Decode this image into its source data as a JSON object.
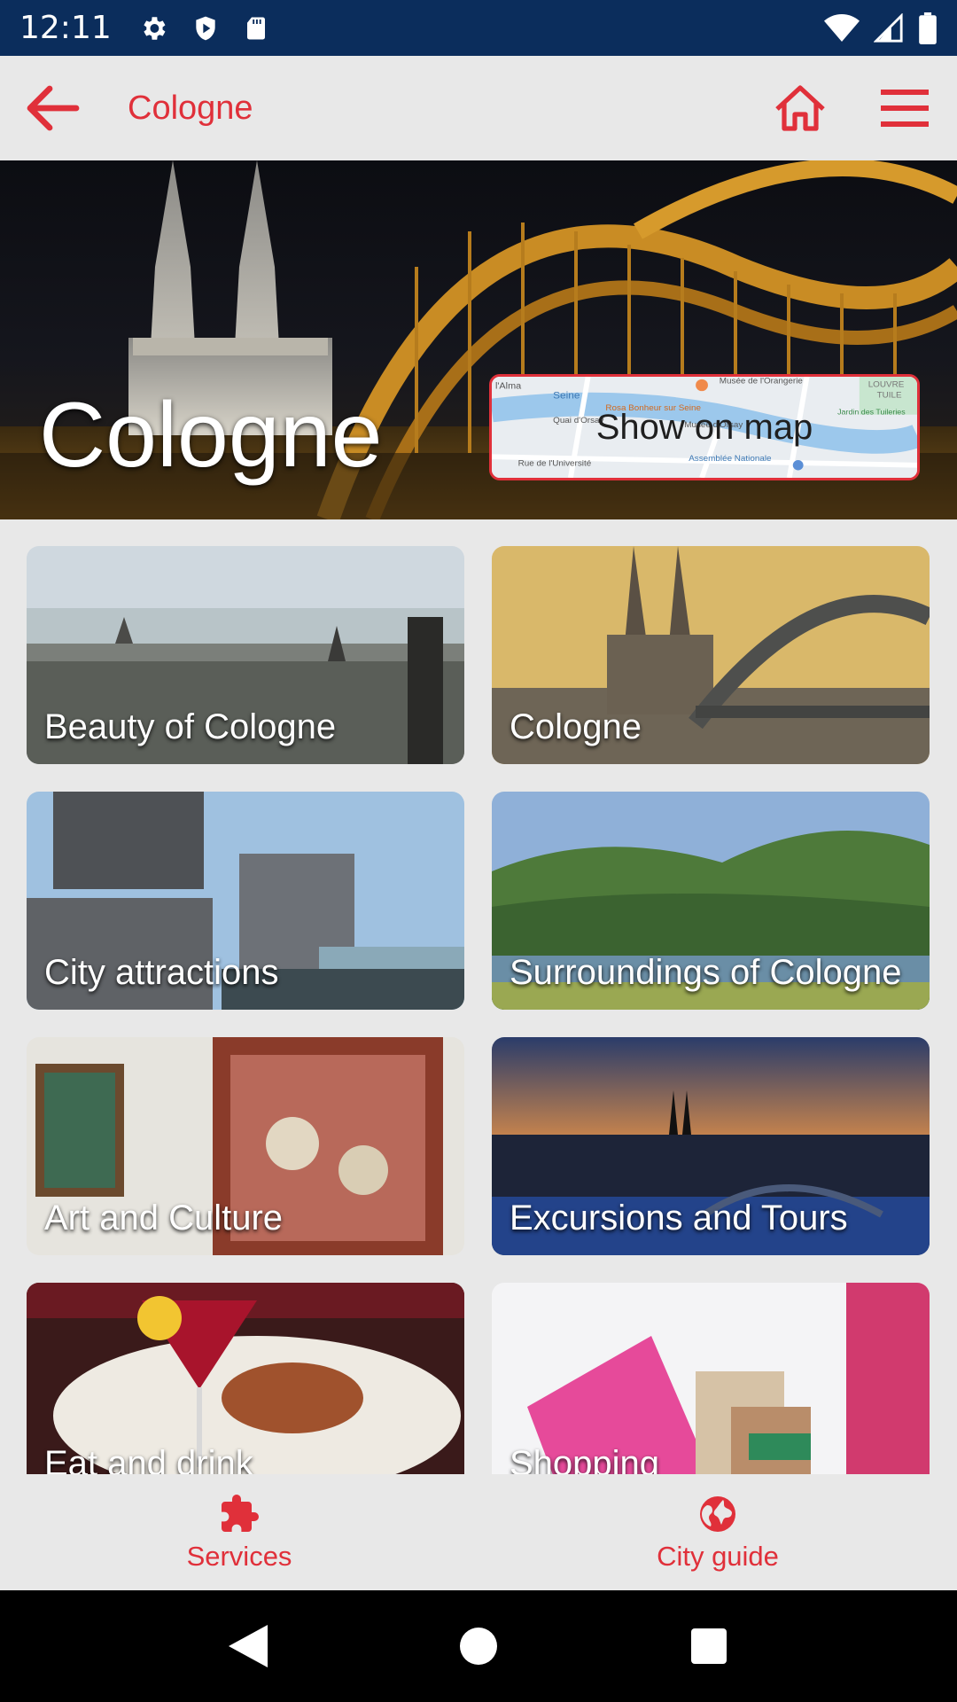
{
  "status_bar": {
    "time": "12:11",
    "icons_left": [
      "settings-icon",
      "shield-icon",
      "sd-card-icon"
    ],
    "icons_right": [
      "wifi-icon",
      "signal-icon",
      "battery-icon"
    ]
  },
  "app_bar": {
    "title": "Cologne",
    "back_icon": "arrow-left-icon",
    "home_icon": "home-icon",
    "menu_icon": "hamburger-menu-icon"
  },
  "hero": {
    "title": "Cologne",
    "map_button_label": "Show on map",
    "map_labels": {
      "alma": "l'Alma",
      "seine": "Seine",
      "orangerie": "Musée de l'Orangerie",
      "rosa": "Rosa Bonheur sur Seine",
      "quai": "Quai d'Orsay",
      "orsay": "Musée d'Orsay",
      "universite": "Rue de l'Université",
      "assemblee": "Assemblée Nationale",
      "louvre": "LOUVRE",
      "tuile": "TUILE",
      "tuileries": "Jardin des Tuileries"
    }
  },
  "tiles": [
    {
      "label": "Beauty of Cologne"
    },
    {
      "label": "Cologne"
    },
    {
      "label": "City attractions"
    },
    {
      "label": "Surroundings of Cologne"
    },
    {
      "label": "Art and Culture"
    },
    {
      "label": "Excursions and Tours"
    },
    {
      "label": "Eat and drink"
    },
    {
      "label": "Shopping"
    }
  ],
  "bottom_nav": {
    "services": {
      "label": "Services",
      "icon": "puzzle-icon"
    },
    "city_guide": {
      "label": "City guide",
      "icon": "globe-icon"
    }
  },
  "system_nav": [
    "back-triangle-icon",
    "home-circle-icon",
    "recents-square-icon"
  ],
  "colors": {
    "accent": "#e0303a",
    "status_bar": "#0b2d5c",
    "background": "#e8e8e8"
  }
}
